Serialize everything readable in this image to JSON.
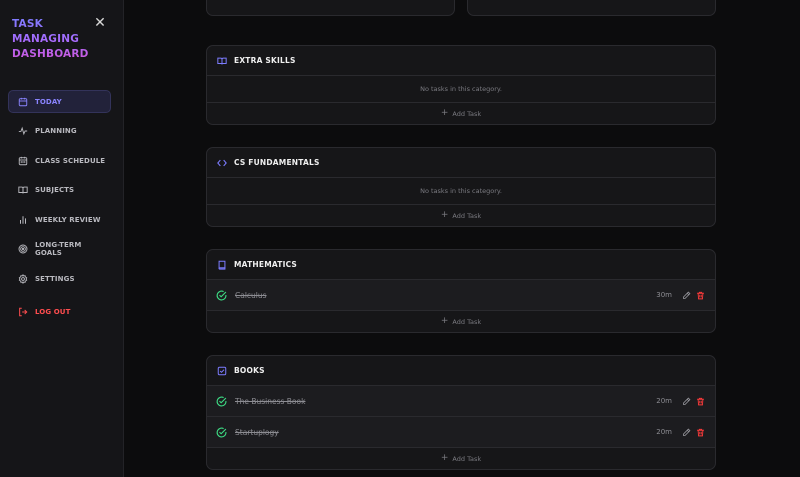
{
  "app": {
    "title_lines": [
      "TASK",
      "MANAGING",
      "DASHBOARD"
    ]
  },
  "sidebar": {
    "items": [
      {
        "label": "TODAY",
        "icon": "calendar-icon",
        "active": true
      },
      {
        "label": "PLANNING",
        "icon": "activity-icon"
      },
      {
        "label": "CLASS SCHEDULE",
        "icon": "calendar-grid-icon"
      },
      {
        "label": "SUBJECTS",
        "icon": "open-book-icon"
      },
      {
        "label": "WEEKLY REVIEW",
        "icon": "bar-chart-icon"
      },
      {
        "label": "LONG-TERM GOALS",
        "icon": "target-icon"
      },
      {
        "label": "SETTINGS",
        "icon": "gear-icon"
      }
    ],
    "logout_label": "LOG OUT"
  },
  "categories": [
    {
      "title": "EXTRA SKILLS",
      "icon": "open-book-icon",
      "empty_text": "No tasks in this category.",
      "add_label": "Add Task"
    },
    {
      "title": "CS FUNDAMENTALS",
      "icon": "code-icon",
      "empty_text": "No tasks in this category.",
      "add_label": "Add Task"
    },
    {
      "title": "MATHEMATICS",
      "icon": "book-icon",
      "add_label": "Add Task",
      "tasks": [
        {
          "name": "Calculus",
          "duration": "30m"
        }
      ]
    },
    {
      "title": "BOOKS",
      "icon": "checkbox-icon",
      "add_label": "Add Task",
      "tasks": [
        {
          "name": "The Business Book",
          "duration": "20m"
        },
        {
          "name": "Startuplogy",
          "duration": "20m"
        }
      ]
    }
  ],
  "colors": {
    "accent": "#7c7cff",
    "danger": "#ff3b3b",
    "success": "#3ddc84"
  }
}
